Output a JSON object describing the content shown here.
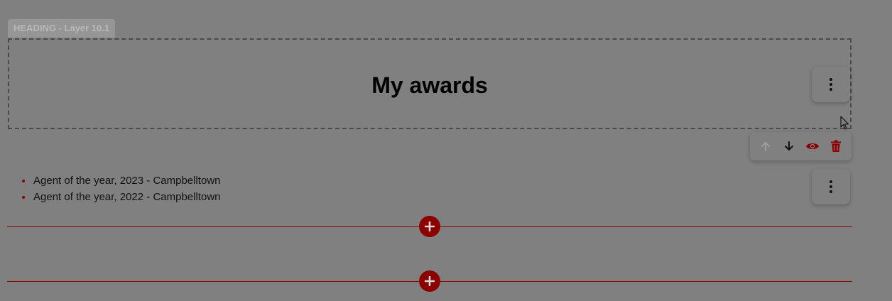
{
  "layer_tag": "HEADING - Layer 10.1",
  "heading": {
    "title": "My awards"
  },
  "awards": {
    "items": [
      "Agent of the year, 2023 - Campbelltown",
      "Agent of the year, 2022 - Campbelltown"
    ]
  },
  "toolbar": {
    "icons": [
      "arrow-up-icon",
      "arrow-down-icon",
      "eye-icon",
      "trash-icon"
    ]
  },
  "colors": {
    "accent": "#8c0000",
    "overlay": "#808080",
    "disabled_icon": "#9e9e9e"
  }
}
